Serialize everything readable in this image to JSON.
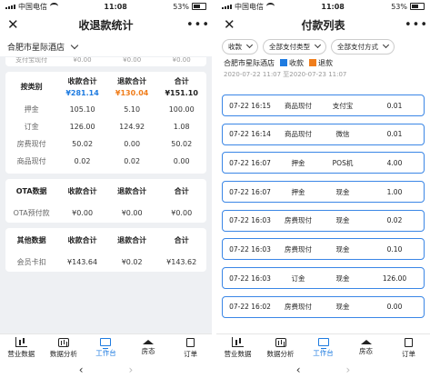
{
  "status_bar": {
    "carrier": "中国电信",
    "time": "11:08",
    "battery": "53%"
  },
  "left": {
    "title": "收退款统计",
    "store": "合肥市星际酒店",
    "cut_top": [
      "支付宝现付",
      "¥0.00",
      "¥0.00",
      "¥0.00"
    ],
    "cards": [
      {
        "header": [
          "按类别",
          "收款合计",
          "退款合计",
          "合计"
        ],
        "totals": [
          "",
          "¥281.14",
          "¥130.04",
          "¥151.10"
        ],
        "rows": [
          [
            "押金",
            "105.10",
            "5.10",
            "100.00"
          ],
          [
            "订金",
            "126.00",
            "124.92",
            "1.08"
          ],
          [
            "房费现付",
            "50.02",
            "0.00",
            "50.02"
          ],
          [
            "商品现付",
            "0.02",
            "0.02",
            "0.00"
          ]
        ]
      },
      {
        "header": [
          "OTA数据",
          "收款合计",
          "退款合计",
          "合计"
        ],
        "rows": [
          [
            "OTA预付款",
            "¥0.00",
            "¥0.00",
            "¥0.00"
          ]
        ]
      },
      {
        "header": [
          "其他数据",
          "收款合计",
          "退款合计",
          "合计"
        ],
        "rows": [
          [
            "会员卡扣",
            "¥143.64",
            "¥0.02",
            "¥143.62"
          ]
        ]
      }
    ]
  },
  "right": {
    "title": "付款列表",
    "filters": [
      "收款",
      "全部支付类型",
      "全部支付方式"
    ],
    "store": "合肥市星际酒店",
    "legend": {
      "receive": "收款",
      "refund": "退款"
    },
    "date_range": "2020-07-22 11:07 至2020-07-23 11:07",
    "payments": [
      [
        "07-22 16:15",
        "商品现付",
        "支付宝",
        "0.01"
      ],
      [
        "07-22 16:14",
        "商品现付",
        "微信",
        "0.01"
      ],
      [
        "07-22 16:07",
        "押金",
        "POS机",
        "4.00"
      ],
      [
        "07-22 16:07",
        "押金",
        "现金",
        "1.00"
      ],
      [
        "07-22 16:03",
        "房费现付",
        "现金",
        "0.02"
      ],
      [
        "07-22 16:03",
        "房费现付",
        "现金",
        "0.10"
      ],
      [
        "07-22 16:03",
        "订金",
        "现金",
        "126.00"
      ],
      [
        "07-22 16:02",
        "房费现付",
        "现金",
        "0.00"
      ]
    ]
  },
  "tabs": [
    "营业数据",
    "数据分析",
    "工作台",
    "房态",
    "订单"
  ],
  "colors": {
    "accent": "#1e7be0",
    "refund": "#f07d1a",
    "border": "#3a86e6"
  },
  "icons": {
    "close": "close-icon",
    "more": "more-icon",
    "chevron": "chevron-down-icon"
  }
}
